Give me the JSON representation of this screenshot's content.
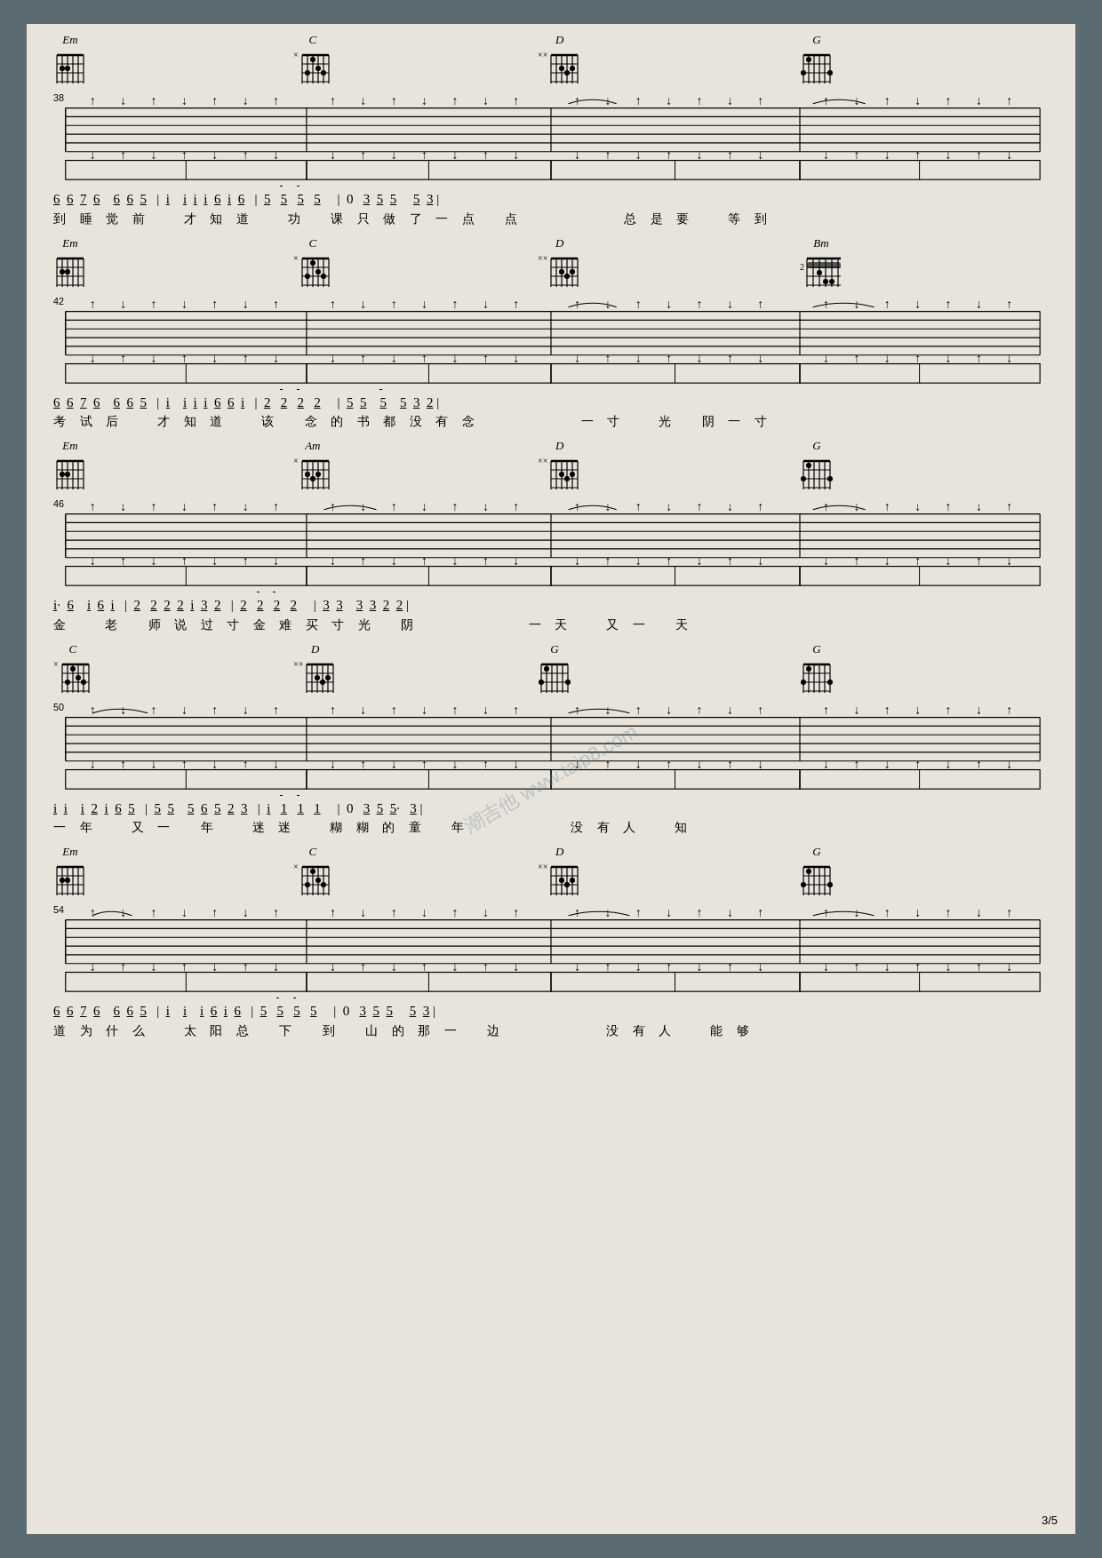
{
  "page": {
    "number": "3/5",
    "background": "#e8e4dc",
    "watermark": "潮吉他 www.taip8.com"
  },
  "sections": [
    {
      "id": "sec38",
      "measure_start": 38,
      "chords": [
        {
          "name": "Em",
          "x_pct": 2,
          "fret": "",
          "muted": []
        },
        {
          "name": "C",
          "x_pct": 27,
          "fret": "×",
          "muted": []
        },
        {
          "name": "D",
          "x_pct": 52,
          "fret": "××",
          "muted": []
        },
        {
          "name": "G",
          "x_pct": 77,
          "fret": "",
          "muted": []
        }
      ],
      "notation": "6 6 7 6   6 6 5  | i   i i i 6 i 6  | 5  5̄  5̄  5   | 0  3 5 5    5 3 |",
      "lyrics": "到 睡 觉 前    才 知 道    功  课 只 做 了 一 点  点           总 是 要   等 到"
    },
    {
      "id": "sec42",
      "measure_start": 42,
      "chords": [
        {
          "name": "Em",
          "x_pct": 2,
          "fret": "",
          "muted": []
        },
        {
          "name": "C",
          "x_pct": 27,
          "fret": "×",
          "muted": []
        },
        {
          "name": "D",
          "x_pct": 52,
          "fret": "××",
          "muted": []
        },
        {
          "name": "Bm",
          "x_pct": 77,
          "fret": "2",
          "muted": []
        }
      ],
      "notation": "6 6 7 6   6 6 5  | i   i i i 6 6 i  | 2  2̄  2̄  2   | 5 5   5̄   5 3 2 |",
      "lyrics": "考 试 后    才 知 道   该  念 的 书 都 没 有 念            一 寸   光  阴 一 寸"
    },
    {
      "id": "sec46",
      "measure_start": 46,
      "chords": [
        {
          "name": "Em",
          "x_pct": 2,
          "fret": "",
          "muted": []
        },
        {
          "name": "Am",
          "x_pct": 27,
          "fret": "×",
          "muted": []
        },
        {
          "name": "D",
          "x_pct": 52,
          "fret": "××",
          "muted": []
        },
        {
          "name": "G",
          "x_pct": 77,
          "fret": "",
          "muted": []
        }
      ],
      "notation": "1·  6   i 6 i  | 2  2 2 2 i 3 2  | 2  2̄  2̄  2   | 3 3   3 3 2 2  |",
      "lyrics": "金   老  师 说 过 寸 金 难 买 寸 光  阴              一 天   又 一  天"
    },
    {
      "id": "sec50",
      "measure_start": 50,
      "chords": [
        {
          "name": "C",
          "x_pct": 2,
          "fret": "×",
          "muted": []
        },
        {
          "name": "D",
          "x_pct": 27,
          "fret": "××",
          "muted": []
        },
        {
          "name": "G",
          "x_pct": 52,
          "fret": "",
          "muted": []
        },
        {
          "name": "G",
          "x_pct": 77,
          "fret": "",
          "muted": []
        }
      ],
      "notation": "i i   i 2 i 6 5  | 5 5   5 6 5 2 3  | i  1̄  1̄  1   | 0  3 5 5·  3  |",
      "lyrics": "一 年   又 一  年    迷 迷   糊 糊 的 童  年              没 有 人   知"
    },
    {
      "id": "sec54",
      "measure_start": 54,
      "chords": [
        {
          "name": "Em",
          "x_pct": 2,
          "fret": "",
          "muted": []
        },
        {
          "name": "C",
          "x_pct": 27,
          "fret": "×",
          "muted": []
        },
        {
          "name": "D",
          "x_pct": 52,
          "fret": "××",
          "muted": []
        },
        {
          "name": "G",
          "x_pct": 77,
          "fret": "",
          "muted": []
        }
      ],
      "notation": "6 6 7 6   6 6 5  | i   i   i 6 i 6  | 5  5̄  5̄  5   | 0  3 5 5    5 3 |",
      "lyrics": "道 为 什 么   太 阳 总  下  到  山 的 那 一  边              没 有 人   能 够"
    }
  ]
}
